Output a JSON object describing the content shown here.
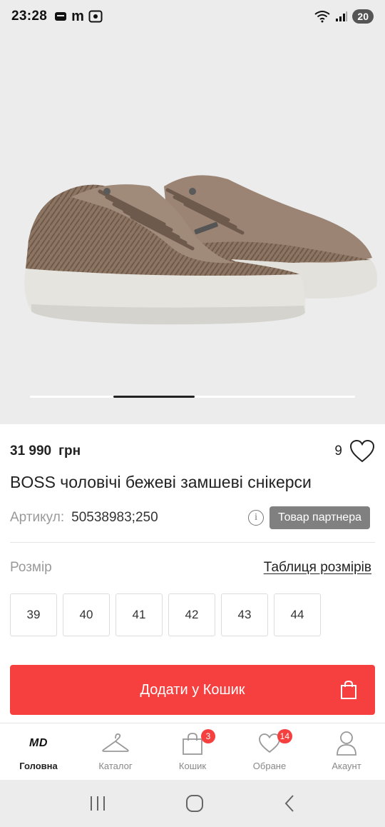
{
  "status_bar": {
    "time": "23:28",
    "app_letter": "m",
    "battery": "20"
  },
  "product": {
    "price": "31 990",
    "currency": "грн",
    "favorites_count": "9",
    "title": "BOSS чоловічі бежеві замшеві снікерси",
    "sku_label": "Артикул:",
    "sku_value": "50538983;250",
    "partner_badge": "Товар партнера",
    "image_index": 2,
    "image_count": 4
  },
  "sizes": {
    "label": "Розмір",
    "table_link": "Таблиця розмірів",
    "options": [
      "39",
      "40",
      "41",
      "42",
      "43",
      "44"
    ]
  },
  "cart_button": {
    "label": "Додати у Кошик"
  },
  "bottom_nav": {
    "items": [
      {
        "label": "Головна",
        "icon": "md-logo",
        "active": true
      },
      {
        "label": "Каталог",
        "icon": "hanger-icon"
      },
      {
        "label": "Кошик",
        "icon": "bag-icon",
        "badge": "3"
      },
      {
        "label": "Обране",
        "icon": "heart-icon",
        "badge": "14"
      },
      {
        "label": "Акаунт",
        "icon": "user-icon"
      }
    ],
    "logo_text": "MD"
  },
  "colors": {
    "accent": "#f5403f",
    "badge_gray": "#808080",
    "background_gray": "#ececec"
  }
}
